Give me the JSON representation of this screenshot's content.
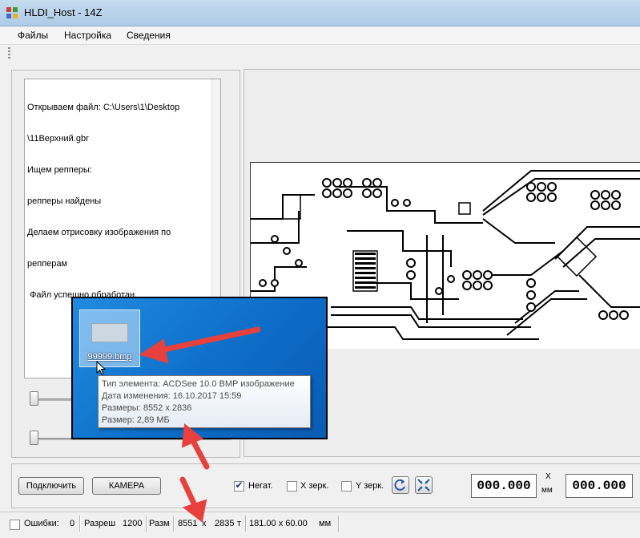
{
  "window": {
    "title": "HLDI_Host - 14Z"
  },
  "menu": {
    "items": [
      "Файлы",
      "Настройка",
      "Сведения"
    ]
  },
  "log": {
    "lines": [
      "Открываем файл: C:\\Users\\1\\Desktop",
      "\\11Верхний.gbr",
      "Ищем репперы:",
      "репперы найдены",
      "Делаем отрисовку изображения по",
      "репперам",
      " Файл успешно обработан."
    ]
  },
  "explorer": {
    "file_name": "99999.bmp",
    "tooltip": {
      "type": "Тип элемента: ACDSee 10.0 BMP изображение",
      "modified": "Дата изменения: 16.10.2017 15:59",
      "dimensions": "Размеры: 8552 x 2836",
      "size": "Размер: 2,89 МБ"
    }
  },
  "controls": {
    "connect_label": "Подключить",
    "camera_label": "КАМЕРА",
    "negative": {
      "label": "Негат.",
      "checked": true
    },
    "mirror_x": {
      "label": "X зерк.",
      "checked": false
    },
    "mirror_y": {
      "label": "Y зерк.",
      "checked": false
    },
    "x_value": "000.000",
    "x_axis": "X",
    "x_unit": "мм",
    "y_value": "000.000"
  },
  "status": {
    "errors_label": "Ошибки:",
    "errors_value": "0",
    "resolution_label": "Разреш",
    "resolution_value": "1200",
    "size_label": "Разм",
    "width_px": "8551",
    "x_sep": "x",
    "height_px": "2835",
    "unit_t": "т",
    "size_mm": "181.00 x 60.00",
    "unit_mm": "мм"
  },
  "colors": {
    "annotation_arrow": "#e8403c",
    "explorer_blue": "#1479d4"
  }
}
